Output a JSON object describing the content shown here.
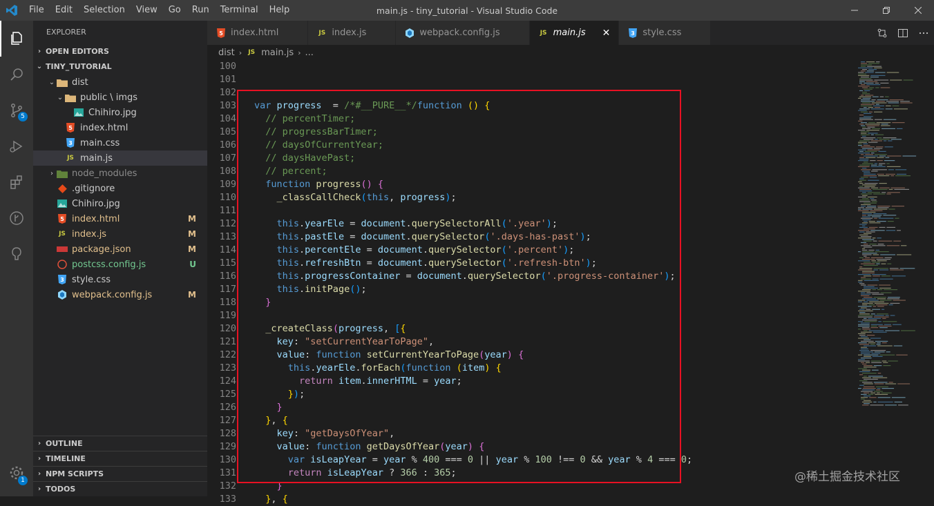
{
  "menu": [
    "File",
    "Edit",
    "Selection",
    "View",
    "Go",
    "Run",
    "Terminal",
    "Help"
  ],
  "window_title": "main.js - tiny_tutorial - Visual Studio Code",
  "activity": {
    "scm_badge": "5",
    "settings_badge": "1"
  },
  "sidebar": {
    "title": "EXPLORER",
    "open_editors": "OPEN EDITORS",
    "project": "TINY_TUTORIAL",
    "tree": [
      {
        "name": "dist",
        "kind": "folder",
        "indent": 1,
        "open": true
      },
      {
        "name": "public \\ imgs",
        "kind": "folder",
        "indent": 2,
        "open": true
      },
      {
        "name": "Chihiro.jpg",
        "kind": "img",
        "indent": 3
      },
      {
        "name": "index.html",
        "kind": "html",
        "indent": 2
      },
      {
        "name": "main.css",
        "kind": "css",
        "indent": 2
      },
      {
        "name": "main.js",
        "kind": "js",
        "indent": 2,
        "selected": true
      },
      {
        "name": "node_modules",
        "kind": "nodefolder",
        "indent": 1,
        "open": false,
        "ignored": true
      },
      {
        "name": ".gitignore",
        "kind": "git",
        "indent": 1
      },
      {
        "name": "Chihiro.jpg",
        "kind": "img",
        "indent": 1
      },
      {
        "name": "index.html",
        "kind": "html",
        "indent": 1,
        "status": "M"
      },
      {
        "name": "index.js",
        "kind": "js",
        "indent": 1,
        "status": "M"
      },
      {
        "name": "package.json",
        "kind": "npm",
        "indent": 1,
        "status": "M"
      },
      {
        "name": "postcss.config.js",
        "kind": "postcss",
        "indent": 1,
        "status": "U"
      },
      {
        "name": "style.css",
        "kind": "css",
        "indent": 1
      },
      {
        "name": "webpack.config.js",
        "kind": "webpack",
        "indent": 1,
        "status": "M"
      }
    ],
    "bottom_sections": [
      "OUTLINE",
      "TIMELINE",
      "NPM SCRIPTS",
      "TODOS"
    ]
  },
  "tabs": [
    {
      "label": "index.html",
      "kind": "html"
    },
    {
      "label": "index.js",
      "kind": "js"
    },
    {
      "label": "webpack.config.js",
      "kind": "webpack"
    },
    {
      "label": "main.js",
      "kind": "js",
      "active": true
    },
    {
      "label": "style.css",
      "kind": "css"
    }
  ],
  "breadcrumb": [
    "dist",
    "main.js",
    "..."
  ],
  "code_lines": [
    {
      "n": "100",
      "t": []
    },
    {
      "n": "101",
      "t": []
    },
    {
      "n": "102",
      "t": []
    },
    {
      "n": "103",
      "t": [
        [
          "kw",
          "var "
        ],
        [
          "vr",
          "progress"
        ],
        [
          "",
          "  = "
        ],
        [
          "cm",
          "/*#__PURE__*/"
        ],
        [
          "kw",
          "function "
        ],
        [
          "br1",
          "()"
        ],
        [
          "",
          " "
        ],
        [
          "br1",
          "{"
        ]
      ]
    },
    {
      "n": "104",
      "t": [
        [
          "",
          "  "
        ],
        [
          "cm",
          "// percentTimer;"
        ]
      ]
    },
    {
      "n": "105",
      "t": [
        [
          "",
          "  "
        ],
        [
          "cm",
          "// progressBarTimer;"
        ]
      ]
    },
    {
      "n": "106",
      "t": [
        [
          "",
          "  "
        ],
        [
          "cm",
          "// daysOfCurrentYear;"
        ]
      ]
    },
    {
      "n": "107",
      "t": [
        [
          "",
          "  "
        ],
        [
          "cm",
          "// daysHavePast;"
        ]
      ]
    },
    {
      "n": "108",
      "t": [
        [
          "",
          "  "
        ],
        [
          "cm",
          "// percent;"
        ]
      ]
    },
    {
      "n": "109",
      "t": [
        [
          "",
          "  "
        ],
        [
          "kw",
          "function "
        ],
        [
          "fn",
          "progress"
        ],
        [
          "br2",
          "()"
        ],
        [
          "",
          " "
        ],
        [
          "br2",
          "{"
        ]
      ]
    },
    {
      "n": "110",
      "t": [
        [
          "",
          "    "
        ],
        [
          "fn",
          "_classCallCheck"
        ],
        [
          "br3",
          "("
        ],
        [
          "kw",
          "this"
        ],
        [
          ", "
        ],
        [
          "vr",
          "progress"
        ],
        [
          "br3",
          ")"
        ],
        [
          "",
          ";"
        ]
      ]
    },
    {
      "n": "111",
      "t": []
    },
    {
      "n": "112",
      "t": [
        [
          "",
          "    "
        ],
        [
          "kw",
          "this"
        ],
        [
          "",
          "."
        ],
        [
          "vr",
          "yearEle"
        ],
        [
          "",
          " = "
        ],
        [
          "vr",
          "document"
        ],
        [
          "",
          "."
        ],
        [
          "fn",
          "querySelectorAll"
        ],
        [
          "br3",
          "("
        ],
        [
          "str",
          "'.year'"
        ],
        [
          "br3",
          ")"
        ],
        [
          "",
          ";"
        ]
      ]
    },
    {
      "n": "113",
      "t": [
        [
          "",
          "    "
        ],
        [
          "kw",
          "this"
        ],
        [
          "",
          "."
        ],
        [
          "vr",
          "pastEle"
        ],
        [
          "",
          " = "
        ],
        [
          "vr",
          "document"
        ],
        [
          "",
          "."
        ],
        [
          "fn",
          "querySelector"
        ],
        [
          "br3",
          "("
        ],
        [
          "str",
          "'.days-has-past'"
        ],
        [
          "br3",
          ")"
        ],
        [
          "",
          ";"
        ]
      ]
    },
    {
      "n": "114",
      "t": [
        [
          "",
          "    "
        ],
        [
          "kw",
          "this"
        ],
        [
          "",
          "."
        ],
        [
          "vr",
          "percentEle"
        ],
        [
          "",
          " = "
        ],
        [
          "vr",
          "document"
        ],
        [
          "",
          "."
        ],
        [
          "fn",
          "querySelector"
        ],
        [
          "br3",
          "("
        ],
        [
          "str",
          "'.percent'"
        ],
        [
          "br3",
          ")"
        ],
        [
          "",
          ";"
        ]
      ]
    },
    {
      "n": "115",
      "t": [
        [
          "",
          "    "
        ],
        [
          "kw",
          "this"
        ],
        [
          "",
          "."
        ],
        [
          "vr",
          "refreshBtn"
        ],
        [
          "",
          " = "
        ],
        [
          "vr",
          "document"
        ],
        [
          "",
          "."
        ],
        [
          "fn",
          "querySelector"
        ],
        [
          "br3",
          "("
        ],
        [
          "str",
          "'.refresh-btn'"
        ],
        [
          "br3",
          ")"
        ],
        [
          "",
          ";"
        ]
      ]
    },
    {
      "n": "116",
      "t": [
        [
          "",
          "    "
        ],
        [
          "kw",
          "this"
        ],
        [
          "",
          "."
        ],
        [
          "vr",
          "progressContainer"
        ],
        [
          "",
          " = "
        ],
        [
          "vr",
          "document"
        ],
        [
          "",
          "."
        ],
        [
          "fn",
          "querySelector"
        ],
        [
          "br3",
          "("
        ],
        [
          "str",
          "'.progress-container'"
        ],
        [
          "br3",
          ")"
        ],
        [
          "",
          ";"
        ]
      ]
    },
    {
      "n": "117",
      "t": [
        [
          "",
          "    "
        ],
        [
          "kw",
          "this"
        ],
        [
          "",
          "."
        ],
        [
          "fn",
          "initPage"
        ],
        [
          "br3",
          "()"
        ],
        [
          "",
          ";"
        ]
      ]
    },
    {
      "n": "118",
      "t": [
        [
          "",
          "  "
        ],
        [
          "br2",
          "}"
        ]
      ]
    },
    {
      "n": "119",
      "t": []
    },
    {
      "n": "120",
      "t": [
        [
          "",
          "  "
        ],
        [
          "fn",
          "_createClass"
        ],
        [
          "br2",
          "("
        ],
        [
          "vr",
          "progress"
        ],
        [
          "",
          ", "
        ],
        [
          "br3",
          "["
        ],
        [
          "br1",
          "{"
        ]
      ]
    },
    {
      "n": "121",
      "t": [
        [
          "",
          "    "
        ],
        [
          "vr",
          "key"
        ],
        [
          "",
          ": "
        ],
        [
          "str",
          "\"setCurrentYearToPage\""
        ],
        [
          "",
          ","
        ]
      ]
    },
    {
      "n": "122",
      "t": [
        [
          "",
          "    "
        ],
        [
          "vr",
          "value"
        ],
        [
          "",
          ": "
        ],
        [
          "kw",
          "function "
        ],
        [
          "fn",
          "setCurrentYearToPage"
        ],
        [
          "br2",
          "("
        ],
        [
          "vr",
          "year"
        ],
        [
          "br2",
          ")"
        ],
        [
          "",
          " "
        ],
        [
          "br2",
          "{"
        ]
      ]
    },
    {
      "n": "123",
      "t": [
        [
          "",
          "      "
        ],
        [
          "kw",
          "this"
        ],
        [
          "",
          "."
        ],
        [
          "vr",
          "yearEle"
        ],
        [
          "",
          "."
        ],
        [
          "fn",
          "forEach"
        ],
        [
          "br3",
          "("
        ],
        [
          "kw",
          "function "
        ],
        [
          "br1",
          "("
        ],
        [
          "vr",
          "item"
        ],
        [
          "br1",
          ")"
        ],
        [
          "",
          " "
        ],
        [
          "br1",
          "{"
        ]
      ]
    },
    {
      "n": "124",
      "t": [
        [
          "",
          "        "
        ],
        [
          "ctl",
          "return "
        ],
        [
          "vr",
          "item"
        ],
        [
          "",
          "."
        ],
        [
          "vr",
          "innerHTML"
        ],
        [
          "",
          " = "
        ],
        [
          "vr",
          "year"
        ],
        [
          "",
          ";"
        ]
      ]
    },
    {
      "n": "125",
      "t": [
        [
          "",
          "      "
        ],
        [
          "br1",
          "}"
        ],
        [
          "br3",
          ")"
        ],
        [
          "",
          ";"
        ]
      ]
    },
    {
      "n": "126",
      "t": [
        [
          "",
          "    "
        ],
        [
          "br2",
          "}"
        ]
      ]
    },
    {
      "n": "127",
      "t": [
        [
          "",
          "  "
        ],
        [
          "br1",
          "}"
        ],
        [
          "",
          ", "
        ],
        [
          "br1",
          "{"
        ]
      ]
    },
    {
      "n": "128",
      "t": [
        [
          "",
          "    "
        ],
        [
          "vr",
          "key"
        ],
        [
          "",
          ": "
        ],
        [
          "str",
          "\"getDaysOfYear\""
        ],
        [
          "",
          ","
        ]
      ]
    },
    {
      "n": "129",
      "t": [
        [
          "",
          "    "
        ],
        [
          "vr",
          "value"
        ],
        [
          "",
          ": "
        ],
        [
          "kw",
          "function "
        ],
        [
          "fn",
          "getDaysOfYear"
        ],
        [
          "br2",
          "("
        ],
        [
          "vr",
          "year"
        ],
        [
          "br2",
          ")"
        ],
        [
          "",
          " "
        ],
        [
          "br2",
          "{"
        ]
      ]
    },
    {
      "n": "130",
      "t": [
        [
          "",
          "      "
        ],
        [
          "kw",
          "var "
        ],
        [
          "vr",
          "isLeapYear"
        ],
        [
          "",
          " = "
        ],
        [
          "vr",
          "year"
        ],
        [
          "",
          " % "
        ],
        [
          "num",
          "400"
        ],
        [
          "",
          " === "
        ],
        [
          "num",
          "0"
        ],
        [
          "",
          " || "
        ],
        [
          "vr",
          "year"
        ],
        [
          "",
          " % "
        ],
        [
          "num",
          "100"
        ],
        [
          "",
          " !== "
        ],
        [
          "num",
          "0"
        ],
        [
          "",
          " && "
        ],
        [
          "vr",
          "year"
        ],
        [
          "",
          " % "
        ],
        [
          "num",
          "4"
        ],
        [
          "",
          " === "
        ],
        [
          "num",
          "0"
        ],
        [
          "",
          ";"
        ]
      ]
    },
    {
      "n": "131",
      "t": [
        [
          "",
          "      "
        ],
        [
          "ctl",
          "return "
        ],
        [
          "vr",
          "isLeapYear"
        ],
        [
          "",
          " ? "
        ],
        [
          "num",
          "366"
        ],
        [
          "",
          " : "
        ],
        [
          "num",
          "365"
        ],
        [
          "",
          ";"
        ]
      ]
    },
    {
      "n": "132",
      "t": [
        [
          "",
          "    "
        ],
        [
          "br2",
          "}"
        ]
      ]
    },
    {
      "n": "133",
      "t": [
        [
          "",
          "  "
        ],
        [
          "br1",
          "}"
        ],
        [
          "",
          ", "
        ],
        [
          "br1",
          "{"
        ]
      ]
    }
  ],
  "watermark": "@稀土掘金技术社区",
  "colors": {
    "highlight_box": "#e81123",
    "accent": "#007acc"
  }
}
